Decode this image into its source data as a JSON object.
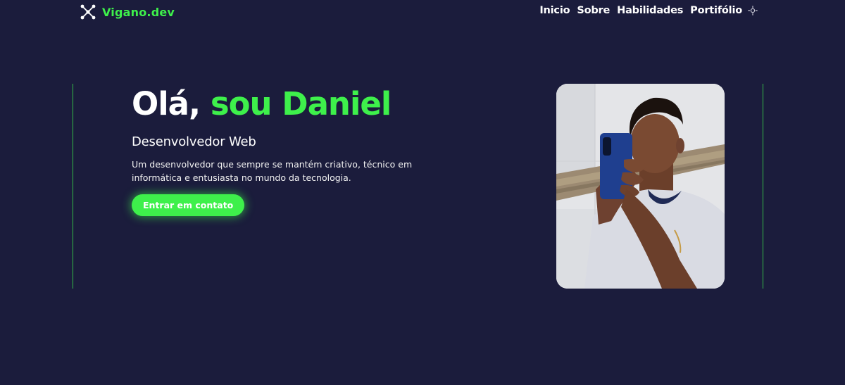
{
  "header": {
    "logo_text": "Vigano.dev",
    "logo_icon": "network-nodes-icon",
    "nav": [
      {
        "label": "Inicio"
      },
      {
        "label": "Sobre"
      },
      {
        "label": "Habilidades"
      },
      {
        "label": "Portifólio"
      }
    ],
    "theme_toggle_icon": "sun-icon"
  },
  "hero": {
    "title_hello": "Olá,",
    "title_name": "sou Daniel",
    "subtitle": "Desenvolvedor Web",
    "description": "Um desenvolvedor que sempre se mantém criativo, técnico em informática e entusiasta no mundo da tecnologia.",
    "cta_label": "Entrar em contato"
  },
  "colors": {
    "background": "#1b1c3c",
    "accent": "#3ef04b",
    "text": "#ffffff"
  }
}
